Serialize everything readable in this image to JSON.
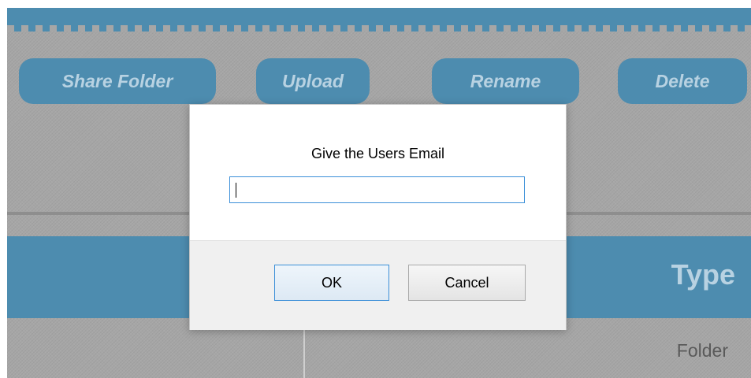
{
  "toolbar": {
    "share_folder_label": "Share Folder",
    "upload_label": "Upload",
    "rename_label": "Rename",
    "delete_label": "Delete"
  },
  "table": {
    "columns": [
      "Type"
    ],
    "rows": [
      {
        "type": "Folder"
      }
    ]
  },
  "dialog": {
    "prompt": "Give the Users Email",
    "input_value": "",
    "ok_label": "OK",
    "cancel_label": "Cancel"
  },
  "colors": {
    "accent": "#4d8caf",
    "accent_text": "#b8d2e2",
    "background": "#a6a6a6",
    "input_focus": "#3b8fd8"
  }
}
